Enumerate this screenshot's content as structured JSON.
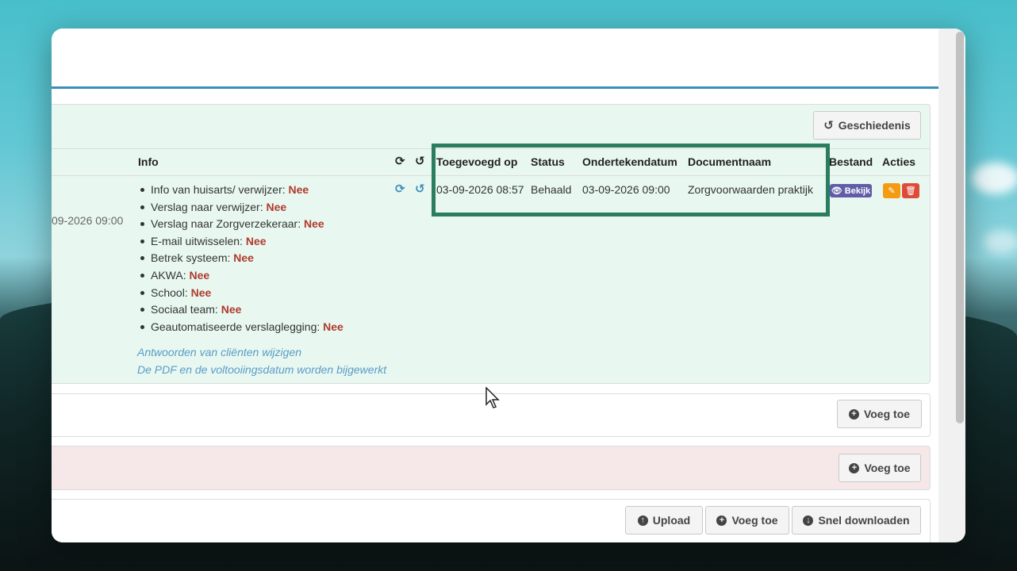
{
  "toolbar": {
    "history_label": "Geschiedenis",
    "add_label_1": "Voeg toe",
    "add_label_2": "Voeg toe",
    "upload_label": "Upload",
    "add_label_3": "Voeg toe",
    "quick_download_label": "Snel downloaden"
  },
  "table": {
    "headers": {
      "info": "Info",
      "added_on": "Toegevoegd op",
      "status": "Status",
      "signed_date": "Ondertekendatum",
      "document_name": "Documentnaam",
      "file": "Bestand",
      "actions": "Acties"
    },
    "row": {
      "left_date": "09-2026 09:00",
      "added_on": "03-09-2026 08:57",
      "status": "Behaald",
      "signed_date": "03-09-2026 09:00",
      "document_name": "Zorgvoorwaarden praktijk",
      "view_label": "Bekijk",
      "info_items": [
        {
          "label": "Info van huisarts/ verwijzer:",
          "value": "Nee"
        },
        {
          "label": "Verslag naar verwijzer:",
          "value": "Nee"
        },
        {
          "label": "Verslag naar Zorgverzekeraar:",
          "value": "Nee"
        },
        {
          "label": "E-mail uitwisselen:",
          "value": "Nee"
        },
        {
          "label": "Betrek systeem:",
          "value": "Nee"
        },
        {
          "label": "AKWA:",
          "value": "Nee"
        },
        {
          "label": "School:",
          "value": "Nee"
        },
        {
          "label": "Sociaal team:",
          "value": "Nee"
        },
        {
          "label": "Geautomatiseerde verslaglegging:",
          "value": "Nee"
        }
      ],
      "links": {
        "edit_answers": "Antwoorden van cliënten wijzigen",
        "pdf_note": "De PDF en de voltooiingsdatum worden bijgewerkt"
      }
    }
  },
  "colors": {
    "highlight_border": "#2a7d5e",
    "nee": "#b03a2e",
    "link": "#5a9bc8",
    "view_badge": "#605ca8",
    "edit": "#f39c12",
    "delete": "#dd4b39",
    "accent_line": "#3c8dbc"
  }
}
